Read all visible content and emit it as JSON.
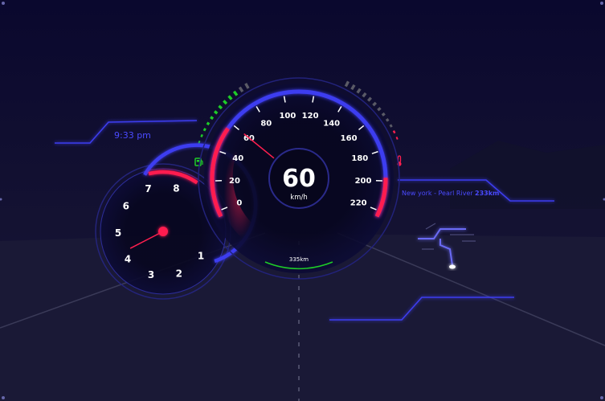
{
  "clock": {
    "time": "9:33 pm"
  },
  "speedometer": {
    "speed": "60",
    "unit": "km/h",
    "ticks": [
      "0",
      "20",
      "40",
      "60",
      "80",
      "100",
      "120",
      "140",
      "160",
      "180",
      "200",
      "220"
    ],
    "needle_value": 60,
    "range_label": "335km"
  },
  "tachometer": {
    "ticks": [
      "1",
      "2",
      "3",
      "4",
      "5",
      "6",
      "7",
      "8"
    ],
    "needle_value": 4.3
  },
  "fuel_gauge": {
    "level_fraction": 0.8,
    "icon": "fuel-pump-icon"
  },
  "temperature_gauge": {
    "level_fraction": 0.15,
    "icon": "thermometer-icon"
  },
  "navigation": {
    "route": "New york - Pearl River",
    "distance": "233km"
  },
  "colors": {
    "accent": "#3d3df0",
    "label": "#4a4aff",
    "red": "#ff1f4f",
    "green": "#1ecc28",
    "grey": "#5a5a66",
    "background": "#08062b"
  }
}
